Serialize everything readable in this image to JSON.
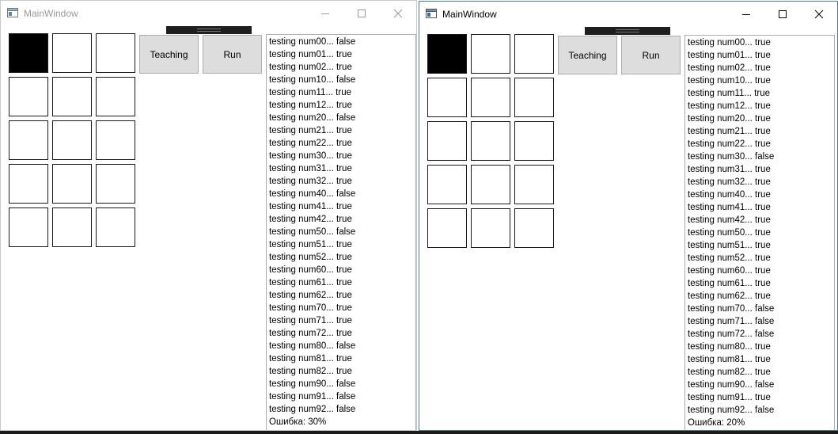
{
  "windows": [
    {
      "title": "MainWindow",
      "teaching_label": "Teaching",
      "run_label": "Run",
      "cells": [
        1,
        0,
        0,
        0,
        0,
        0,
        0,
        0,
        0,
        0,
        0,
        0,
        0,
        0,
        0
      ],
      "log": [
        "testing num00... false",
        "testing num01... true",
        "testing num02... true",
        "testing num10... false",
        "testing num11... true",
        "testing num12... true",
        "testing num20... false",
        "testing num21... true",
        "testing num22... true",
        "testing num30... true",
        "testing num31... true",
        "testing num32... true",
        "testing num40... false",
        "testing num41... true",
        "testing num42... true",
        "testing num50... false",
        "testing num51... true",
        "testing num52... true",
        "testing num60... true",
        "testing num61... true",
        "testing num62... true",
        "testing num70... true",
        "testing num71... true",
        "testing num72... true",
        "testing num80... false",
        "testing num81... true",
        "testing num82... true",
        "testing num90... false",
        "testing num91... false",
        "testing num92... false",
        "Ошибка: 30%"
      ]
    },
    {
      "title": "MainWindow",
      "teaching_label": "Teaching",
      "run_label": "Run",
      "cells": [
        1,
        0,
        0,
        0,
        0,
        0,
        0,
        0,
        0,
        0,
        0,
        0,
        0,
        0,
        0
      ],
      "log": [
        "testing num00... true",
        "testing num01... true",
        "testing num02... true",
        "testing num10... true",
        "testing num11... true",
        "testing num12... true",
        "testing num20... true",
        "testing num21... true",
        "testing num22... true",
        "testing num30... false",
        "testing num31... true",
        "testing num32... true",
        "testing num40... true",
        "testing num41... true",
        "testing num42... true",
        "testing num50... true",
        "testing num51... true",
        "testing num52... true",
        "testing num60... true",
        "testing num61... true",
        "testing num62... true",
        "testing num70... false",
        "testing num71... false",
        "testing num72... false",
        "testing num80... true",
        "testing num81... true",
        "testing num82... true",
        "testing num90... false",
        "testing num91... true",
        "testing num92... false",
        "Ошибка: 20%"
      ]
    }
  ]
}
